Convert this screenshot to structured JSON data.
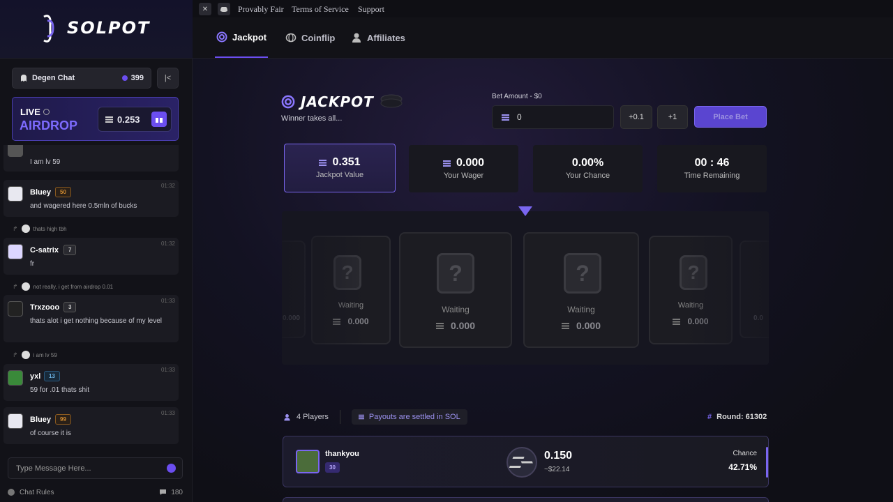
{
  "brand": {
    "name": "SOLPOT"
  },
  "chat": {
    "title": "Degen Chat",
    "online": "399",
    "collapse_icon": "|<",
    "airdrop": {
      "live": "LIVE",
      "title": "AIRDROP",
      "amount": "0.253"
    },
    "partial_top": "I am lv 59",
    "messages": [
      {
        "name": "Bluey",
        "level": "50",
        "time": "01:32",
        "text": "and wagered here 0.5mln of bucks",
        "level_color": "#d08a30"
      },
      {
        "name": "C-satrix",
        "level": "7",
        "time": "01:32",
        "text": "fr",
        "level_color": "#9a9aa0",
        "reply": "thats high tbh"
      },
      {
        "name": "Trxzooo",
        "level": "3",
        "time": "01:33",
        "text": "thats alot i get nothing because of my level",
        "level_color": "#9a9aa0",
        "reply": "not really, i get from airdrop 0.01"
      },
      {
        "name": "yxl",
        "level": "13",
        "time": "01:33",
        "text": "59 for .01 thats shit",
        "level_color": "#4a9ad0",
        "reply": "i am lv 59"
      },
      {
        "name": "Bluey",
        "level": "99",
        "time": "01:33",
        "text": "of course it is",
        "level_color": "#d08a30"
      }
    ],
    "input_placeholder": "Type Message Here...",
    "rules": "Chat Rules",
    "msg_count": "180"
  },
  "topbar": {
    "links": [
      "Provably Fair",
      "Terms of Service",
      "Support"
    ]
  },
  "nav": {
    "tabs": [
      "Jackpot",
      "Coinflip",
      "Affiliates"
    ]
  },
  "jackpot": {
    "title": "JACKPOT",
    "subtitle": "Winner takes all...",
    "bet_label": "Bet Amount - $0",
    "bet_value": "0",
    "plus01": "+0.1",
    "plus1": "+1",
    "place_bet": "Place Bet",
    "stats": [
      {
        "value": "0.351",
        "label": "Jackpot Value"
      },
      {
        "value": "0.000",
        "label": "Your Wager"
      },
      {
        "value": "0.00%",
        "label": "Your Chance"
      },
      {
        "value": "00 : 46",
        "label": "Time Remaining"
      }
    ],
    "reel": {
      "waiting": "Waiting",
      "amount": "0.000",
      "q": "?",
      "partial_left": "0.000",
      "partial_right": "0.0"
    },
    "players_label": "4 Players",
    "payout_note": "Payouts are settled in SOL",
    "round": "Round: 61302"
  },
  "player": {
    "name": "thankyou",
    "level": "30",
    "amount": "0.150",
    "usd": "~$22.14",
    "chance_label": "Chance",
    "chance": "42.71%"
  },
  "colors": {
    "accent": "#6b4ef0",
    "bg": "#0d0d12"
  }
}
